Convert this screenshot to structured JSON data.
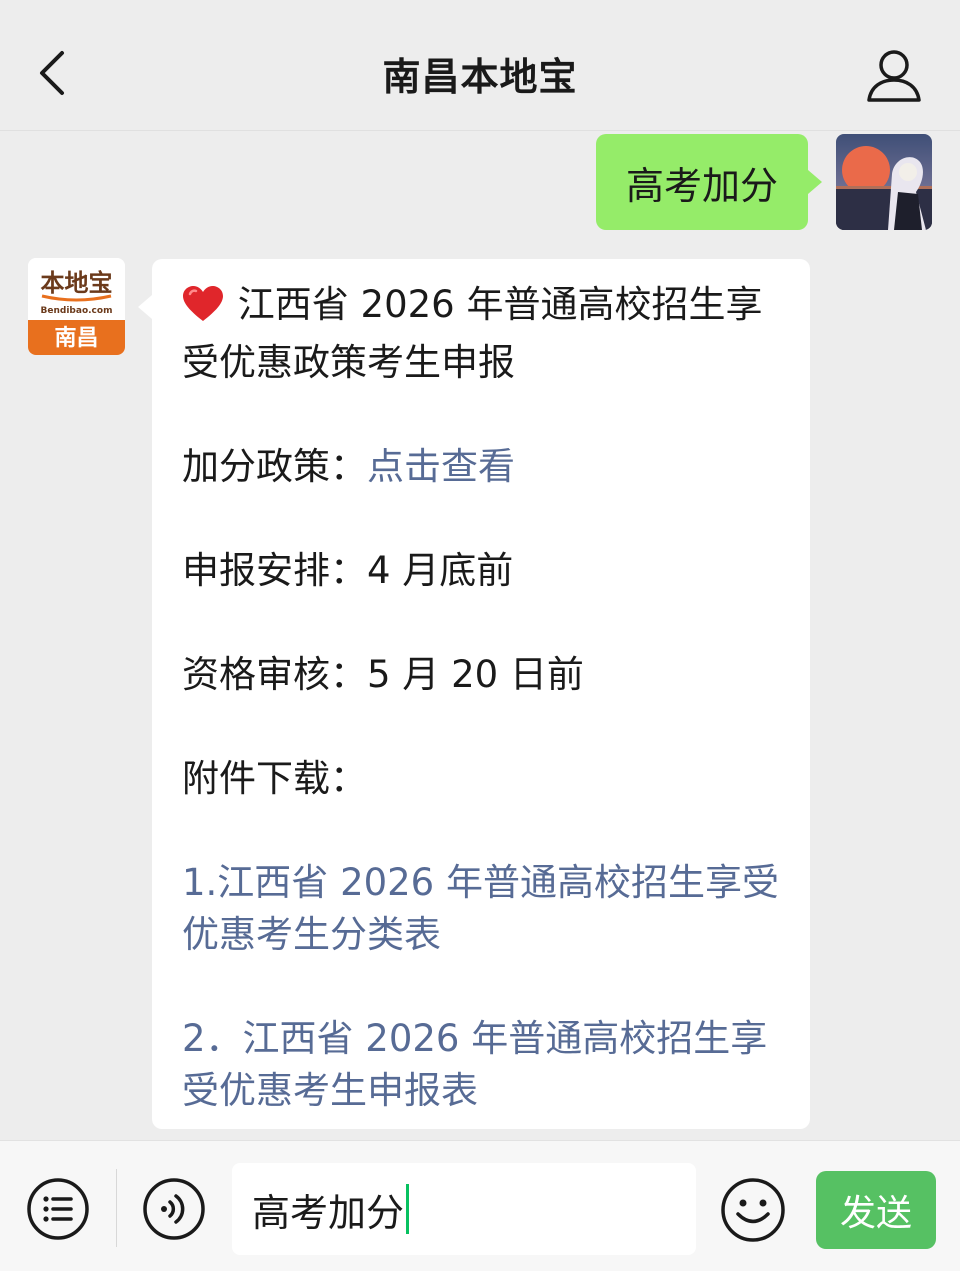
{
  "header": {
    "title": "南昌本地宝"
  },
  "conversation": {
    "user_message": "高考加分",
    "bot_avatar": {
      "logo_text": "本地宝",
      "logo_sub": "Bendibao.com",
      "city": "南昌"
    },
    "bot_message": {
      "title": "江西省 2026 年普通高校招生享受优惠政策考生申报",
      "policy_label": "加分政策：",
      "policy_link": "点击查看",
      "schedule": "申报安排：4 月底前",
      "review": "资格审核：5 月 20 日前",
      "attachments_label": "附件下载：",
      "attachment_1": "1.江西省 2026 年普通高校招生享受优惠考生分类表",
      "attachment_2": "2．江西省 2026 年普通高校招生享受优惠考生申报表"
    }
  },
  "composer": {
    "input_value": "高考加分",
    "send_label": "发送"
  },
  "colors": {
    "user_bubble": "#95ec69",
    "link": "#576b95",
    "send_button": "#56c163",
    "logo_orange": "#e8701e"
  }
}
